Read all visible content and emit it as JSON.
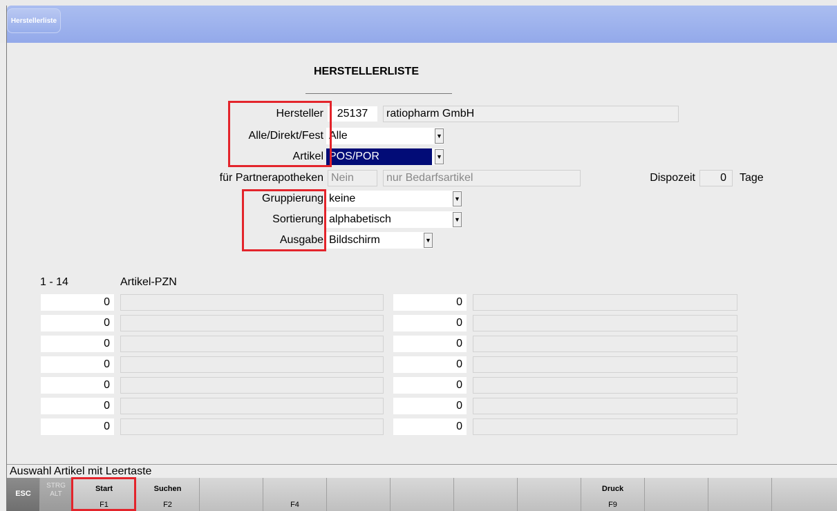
{
  "window": {
    "tab_label": "Herstellerliste"
  },
  "form": {
    "title": "HERSTELLERLISTE",
    "hersteller_label": "Hersteller",
    "hersteller_nr": "25137",
    "hersteller_name": "ratiopharm GmbH",
    "alle_label": "Alle/Direkt/Fest",
    "alle_value": "Alle",
    "artikel_label": "Artikel",
    "artikel_value": "POS/POR",
    "partner_label": "für Partnerapotheken",
    "partner_value": "Nein",
    "bedarf_value": "nur Bedarfsartikel",
    "dispozeit_label": "Dispozeit",
    "dispozeit_value": "0",
    "tage_label": "Tage",
    "gruppierung_label": "Gruppierung",
    "gruppierung_value": "keine",
    "sortierung_label": "Sortierung",
    "sortierung_value": "alphabetisch",
    "ausgabe_label": "Ausgabe",
    "ausgabe_value": "Bildschirm"
  },
  "list": {
    "range": "1 - 14",
    "column_header": "Artikel-PZN",
    "left_values": [
      "0",
      "0",
      "0",
      "0",
      "0",
      "0",
      "0"
    ],
    "right_values": [
      "0",
      "0",
      "0",
      "0",
      "0",
      "0",
      "0"
    ]
  },
  "status": {
    "text": "Auswahl Artikel mit Leertaste"
  },
  "fkeys": {
    "esc": "ESC",
    "strg": "STRG",
    "alt": "ALT",
    "start_label": "Start",
    "start_key": "F1",
    "suchen_label": "Suchen",
    "suchen_key": "F2",
    "f4_key": "F4",
    "druck_label": "Druck",
    "druck_key": "F9"
  },
  "colors": {
    "highlight": "#e3242b",
    "selection": "#020c77",
    "titlebar": "#93a9ea"
  }
}
